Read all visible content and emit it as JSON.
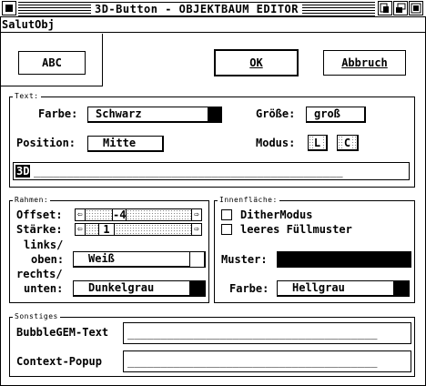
{
  "window": {
    "title": "3D-Button - OBJEKTBAUM EDITOR"
  },
  "menu": {
    "item": "SalutObj"
  },
  "preview": {
    "button_label": "ABC"
  },
  "buttons": {
    "ok": "OK",
    "cancel": "Abbruch"
  },
  "text_group": {
    "title": "Text:",
    "color_label": "Farbe:",
    "color_value": "Schwarz",
    "size_label": "Größe:",
    "size_value": "groß",
    "position_label": "Position:",
    "position_value": "Mitte",
    "mode_label": "Modus:",
    "mode_a": "L",
    "mode_b": "C",
    "text_value": "3D",
    "text_placeholder": "_______________________________________________"
  },
  "frame_group": {
    "title": "Rahmen:",
    "offset_label": "Offset:",
    "offset_value": "-4",
    "strength_label": "Stärke:",
    "strength_value": "1",
    "left_top_label_1": "links/",
    "left_top_label_2": "oben:",
    "left_top_value": "Weiß",
    "right_bottom_label_1": "rechts/",
    "right_bottom_label_2": "unten:",
    "right_bottom_value": "Dunkelgrau"
  },
  "fill_group": {
    "title": "Innenfläche:",
    "dither_label": "DitherModus",
    "empty_label": "leeres Füllmuster",
    "pattern_label": "Muster:",
    "color_label": "Farbe:",
    "color_value": "Hellgrau"
  },
  "misc_group": {
    "title": "Sonstiges",
    "bubble_label": "BubbleGEM-Text",
    "bubble_value": "______________________________________",
    "popup_label": "Context-Popup",
    "popup_value": "______________________________________"
  }
}
